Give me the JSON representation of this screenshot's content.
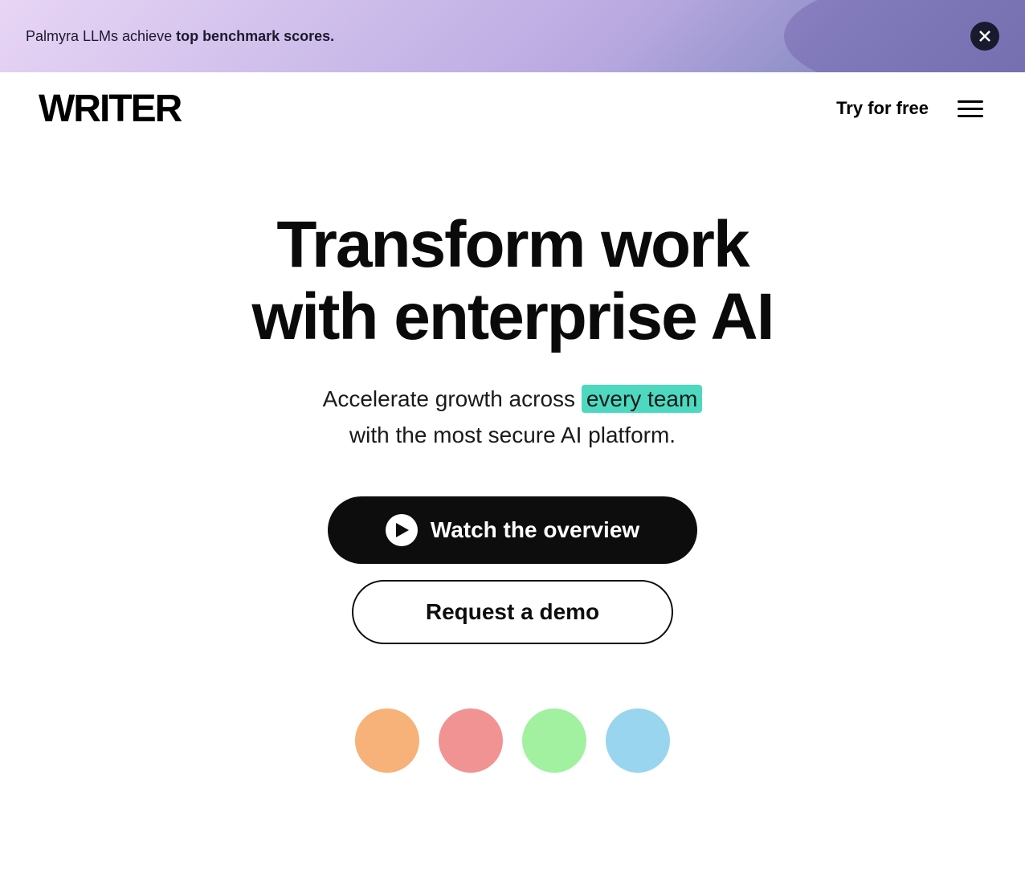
{
  "banner": {
    "text_normal": "Palmyra LLMs achieve ",
    "text_bold": "top benchmark scores.",
    "close_aria": "Close banner"
  },
  "navbar": {
    "logo": "WRITER",
    "try_free_label": "Try for free",
    "menu_aria": "Open menu"
  },
  "hero": {
    "title_line1": "Transform work",
    "title_line2": "with enterprise AI",
    "subtitle_prefix": "Accelerate growth across ",
    "subtitle_highlight": "every team",
    "subtitle_line2": "with the most secure AI platform.",
    "watch_btn_label": "Watch the overview",
    "demo_btn_label": "Request a demo"
  },
  "colors": {
    "highlight_bg": "#4dd9c0",
    "banner_gradient_start": "#e8d5f5",
    "banner_gradient_end": "#8080b8",
    "dark": "#0d0d0d",
    "white": "#ffffff"
  },
  "bottom_circles": [
    {
      "size": 80,
      "color": "#f4a460"
    },
    {
      "size": 80,
      "color": "#f08080"
    },
    {
      "size": 80,
      "color": "#90ee90"
    },
    {
      "size": 80,
      "color": "#87ceeb"
    }
  ]
}
